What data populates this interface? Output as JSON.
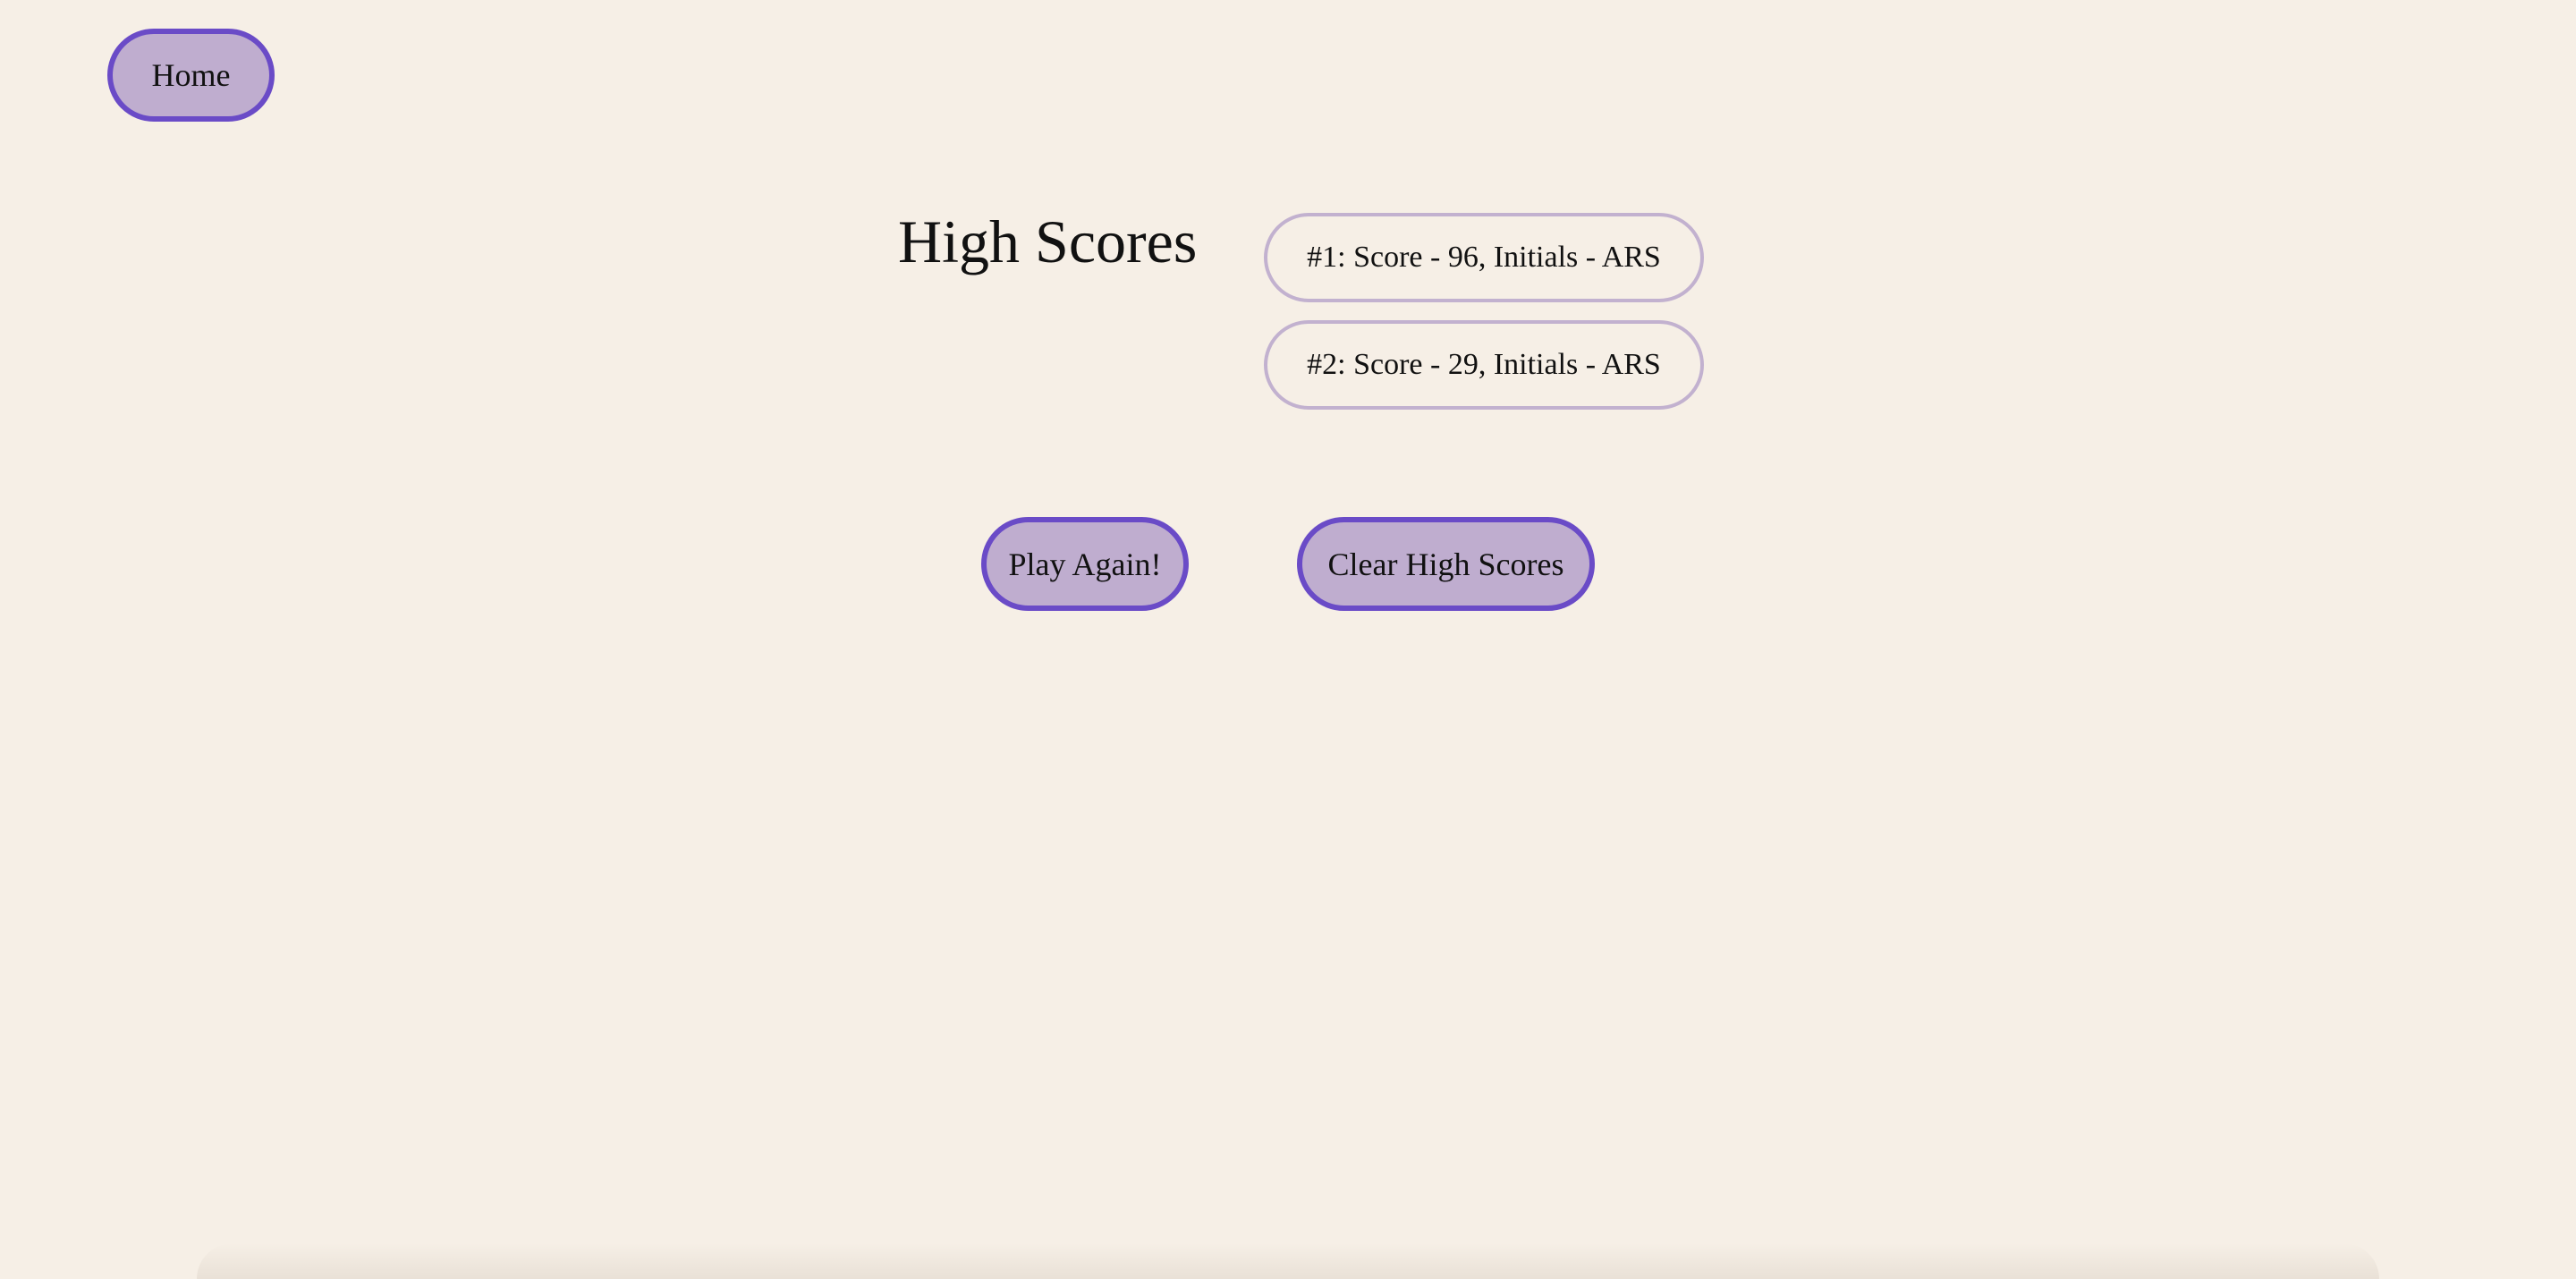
{
  "nav": {
    "home_label": "Home"
  },
  "high_scores": {
    "title": "High Scores",
    "entries": [
      "#1: Score - 96, Initials - ARS",
      "#2: Score - 29, Initials - ARS"
    ]
  },
  "actions": {
    "play_again_label": "Play Again!",
    "clear_label": "Clear High Scores"
  },
  "colors": {
    "background": "#f6efe6",
    "button_fill": "#bfadcf",
    "button_border": "#6a4bc7",
    "score_border": "#c2b1cf",
    "text": "#111111"
  }
}
